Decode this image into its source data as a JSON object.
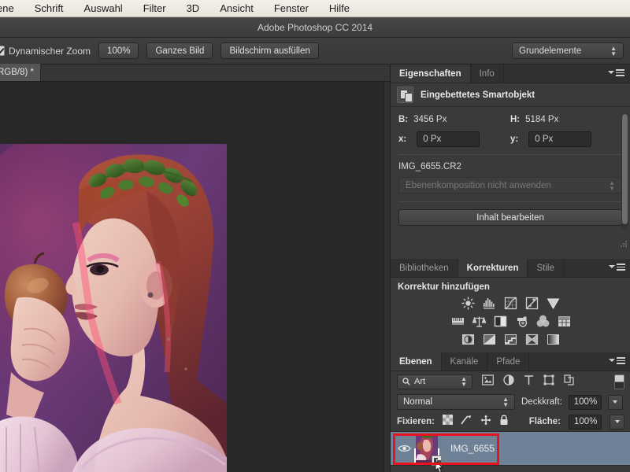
{
  "menubar": {
    "items": [
      {
        "label": "ene"
      },
      {
        "label": "Schrift"
      },
      {
        "label": "Auswahl"
      },
      {
        "label": "Filter"
      },
      {
        "label": "3D"
      },
      {
        "label": "Ansicht"
      },
      {
        "label": "Fenster"
      },
      {
        "label": "Hilfe"
      }
    ]
  },
  "titlebar": {
    "title": "Adobe Photoshop CC 2014"
  },
  "options_bar": {
    "dynamic_zoom_checked": true,
    "dynamic_zoom_label": "Dynamischer Zoom",
    "zoom_100_label": "100%",
    "fit_image_label": "Ganzes Bild",
    "fill_screen_label": "Bildschirm ausfüllen",
    "workspace_label": "Grundelemente"
  },
  "document_tab": {
    "label": "RGB/8) *"
  },
  "properties": {
    "tabs": [
      {
        "label": "Eigenschaften",
        "active": true
      },
      {
        "label": "Info",
        "active": false
      }
    ],
    "header_title": "Eingebettetes Smartobjekt",
    "header_icon": "smart-object-icon",
    "width_label": "B:",
    "width_value": "3456 Px",
    "height_label": "H:",
    "height_value": "5184 Px",
    "x_label": "x:",
    "x_value": "0 Px",
    "y_label": "y:",
    "y_value": "0 Px",
    "file_name": "IMG_6655.CR2",
    "layer_comp_value": "Ebenenkomposition nicht anwenden",
    "edit_content_label": "Inhalt bearbeiten"
  },
  "corrections": {
    "tabs": [
      {
        "label": "Bibliotheken",
        "active": false
      },
      {
        "label": "Korrekturen",
        "active": true
      },
      {
        "label": "Stile",
        "active": false
      }
    ],
    "section_title": "Korrektur hinzufügen",
    "icon_rows": [
      [
        {
          "name": "brightness-contrast-icon"
        },
        {
          "name": "levels-icon"
        },
        {
          "name": "curves-icon"
        },
        {
          "name": "exposure-icon"
        },
        {
          "name": "vibrance-icon"
        }
      ],
      [
        {
          "name": "hue-saturation-icon"
        },
        {
          "name": "color-balance-icon"
        },
        {
          "name": "black-white-icon"
        },
        {
          "name": "photo-filter-icon"
        },
        {
          "name": "channel-mixer-icon"
        },
        {
          "name": "color-lookup-icon"
        }
      ],
      [
        {
          "name": "invert-icon"
        },
        {
          "name": "posterize-icon"
        },
        {
          "name": "threshold-icon"
        },
        {
          "name": "selective-color-icon"
        },
        {
          "name": "gradient-map-icon"
        }
      ]
    ]
  },
  "layers": {
    "tabs": [
      {
        "label": "Ebenen",
        "active": true
      },
      {
        "label": "Kanäle",
        "active": false
      },
      {
        "label": "Pfade",
        "active": false
      }
    ],
    "filter_kind_label": "Art",
    "filter_icons": [
      {
        "name": "filter-pixel-layers-icon"
      },
      {
        "name": "filter-adjustment-layers-icon"
      },
      {
        "name": "filter-type-layers-icon"
      },
      {
        "name": "filter-shape-layers-icon"
      },
      {
        "name": "filter-smart-objects-icon"
      }
    ],
    "filter_toggle_name": "filter-enable-toggle",
    "blend_mode": "Normal",
    "opacity_label": "Deckkraft:",
    "opacity_value": "100%",
    "lock_label": "Fixieren:",
    "lock_icons": [
      {
        "name": "lock-transparency-icon"
      },
      {
        "name": "lock-image-icon"
      },
      {
        "name": "lock-position-icon"
      },
      {
        "name": "lock-all-icon"
      }
    ],
    "fill_label": "Fläche:",
    "fill_value": "100%",
    "rows": [
      {
        "name": "IMG_6655",
        "visible": true,
        "selected": true,
        "is_smart_object": true,
        "highlighted": true
      }
    ]
  },
  "annotation": {
    "highlight_color": "#e8131c"
  },
  "canvas": {
    "zoom": "100%",
    "image_alt": "portrait-photograph"
  }
}
